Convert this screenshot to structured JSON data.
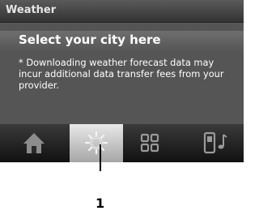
{
  "window": {
    "title": "Weather"
  },
  "card": {
    "heading": "Select your city here",
    "notice": "* Downloading weather forecast data may incur additional data transfer fees from your provider."
  },
  "tabs": [
    {
      "icon": "home-icon",
      "active": false
    },
    {
      "icon": "sun-icon",
      "active": true
    },
    {
      "icon": "grid-icon",
      "active": false
    },
    {
      "icon": "phone-music-icon",
      "active": false
    }
  ],
  "callout": {
    "number": "1"
  }
}
